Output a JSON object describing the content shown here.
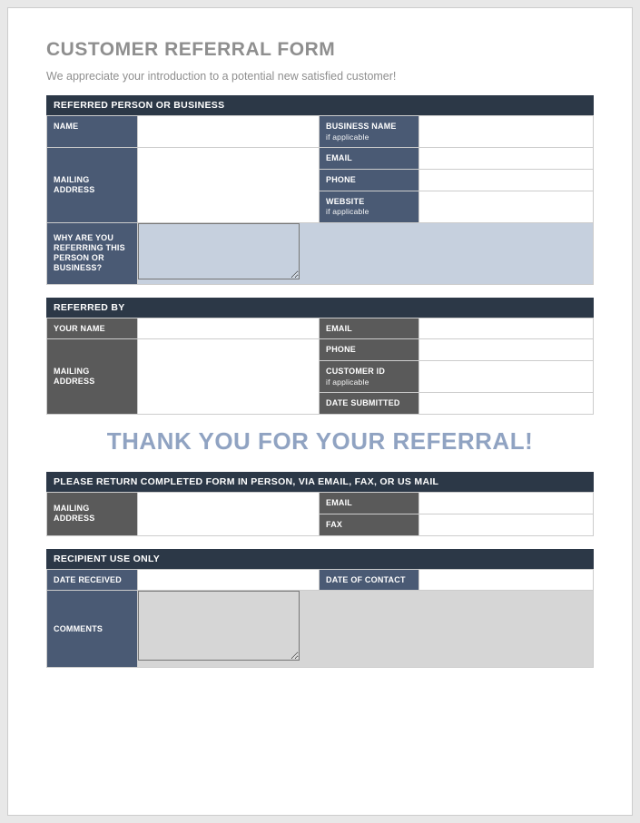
{
  "title": "CUSTOMER REFERRAL FORM",
  "intro": "We appreciate your introduction to a potential new satisfied customer!",
  "thanks": "THANK YOU FOR YOUR REFERRAL!",
  "sec1": {
    "header": "REFERRED PERSON OR BUSINESS",
    "name": "NAME",
    "business": "BUSINESS NAME",
    "business_sub": "if applicable",
    "mailing": "MAILING ADDRESS",
    "email": "EMAIL",
    "phone": "PHONE",
    "website": "WEBSITE",
    "website_sub": "if applicable",
    "why": "WHY ARE YOU REFERRING THIS PERSON OR BUSINESS?"
  },
  "sec2": {
    "header": "REFERRED BY",
    "yourname": "YOUR NAME",
    "email": "EMAIL",
    "mailing": "MAILING ADDRESS",
    "phone": "PHONE",
    "custid": "CUSTOMER ID",
    "custid_sub": "if applicable",
    "date": "DATE SUBMITTED"
  },
  "sec3": {
    "header": "PLEASE RETURN COMPLETED FORM IN PERSON, VIA EMAIL, FAX, OR US MAIL",
    "mailing": "MAILING ADDRESS",
    "email": "EMAIL",
    "fax": "FAX"
  },
  "sec4": {
    "header": "RECIPIENT USE ONLY",
    "received": "DATE RECEIVED",
    "contact": "DATE OF CONTACT",
    "comments": "COMMENTS"
  }
}
